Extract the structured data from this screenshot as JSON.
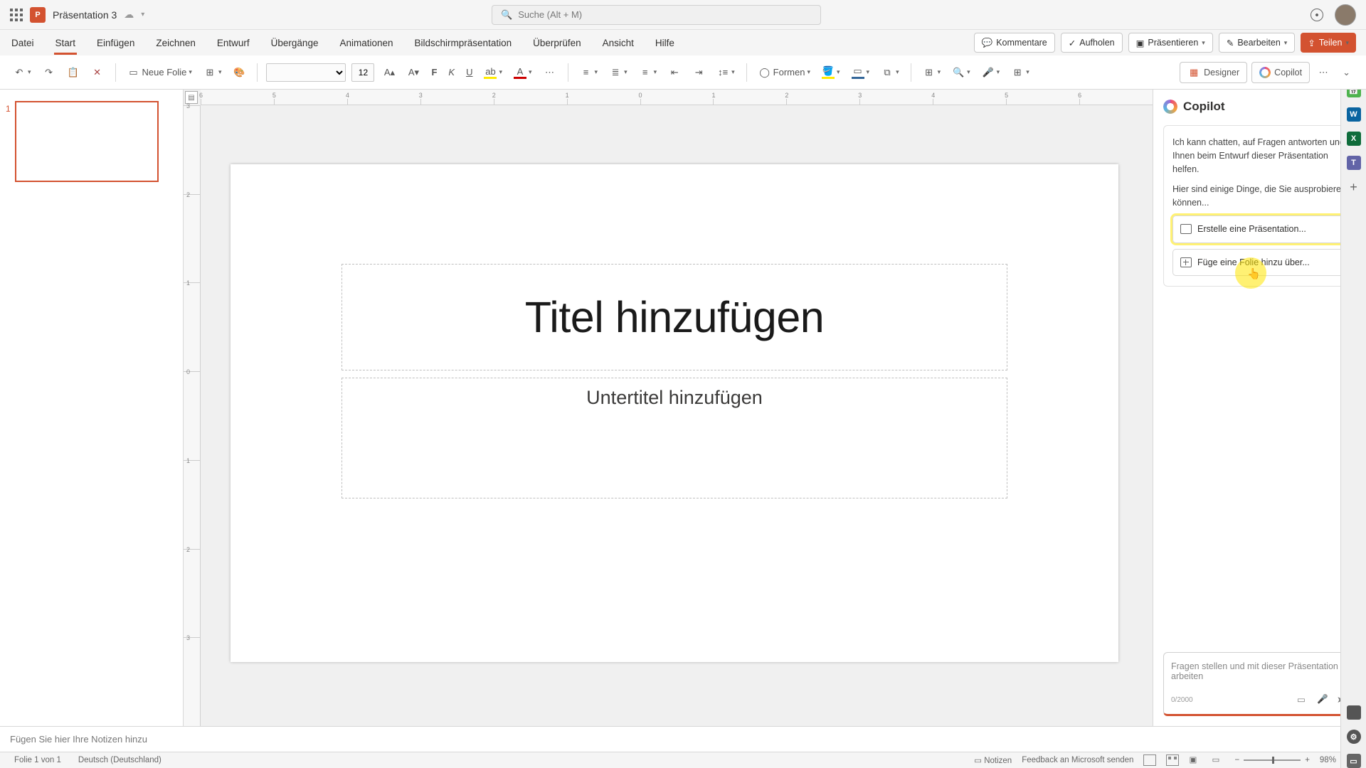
{
  "titlebar": {
    "doc_name": "Präsentation 3",
    "search_placeholder": "Suche (Alt + M)"
  },
  "tabs": {
    "datei": "Datei",
    "start": "Start",
    "einfuegen": "Einfügen",
    "zeichnen": "Zeichnen",
    "entwurf": "Entwurf",
    "uebergaenge": "Übergänge",
    "animationen": "Animationen",
    "bildschirm": "Bildschirmpräsentation",
    "ueberpruefen": "Überprüfen",
    "ansicht": "Ansicht",
    "hilfe": "Hilfe"
  },
  "ribbon_right": {
    "kommentare": "Kommentare",
    "aufholen": "Aufholen",
    "praesentieren": "Präsentieren",
    "bearbeiten": "Bearbeiten",
    "teilen": "Teilen"
  },
  "tools": {
    "neue_folie": "Neue Folie",
    "font_size": "12",
    "formen": "Formen",
    "designer": "Designer",
    "copilot": "Copilot"
  },
  "ruler_h": [
    "6",
    "5",
    "4",
    "3",
    "2",
    "1",
    "0",
    "1",
    "2",
    "3",
    "4",
    "5",
    "6"
  ],
  "ruler_v": [
    "3",
    "2",
    "1",
    "0",
    "1",
    "2",
    "3"
  ],
  "slide": {
    "title": "Titel hinzufügen",
    "subtitle": "Untertitel hinzufügen"
  },
  "thumb_num": "1",
  "copilot": {
    "title": "Copilot",
    "intro": "Ich kann chatten, auf Fragen antworten und Ihnen beim Entwurf dieser Präsentation helfen.",
    "try": "Hier sind einige Dinge, die Sie ausprobieren können...",
    "sugg1": "Erstelle eine Präsentation...",
    "sugg2": "Füge eine Folie hinzu über...",
    "input_ph": "Fragen stellen und mit dieser Präsentation arbeiten",
    "counter": "0/2000"
  },
  "notes": "Fügen Sie hier Ihre Notizen hinzu",
  "status": {
    "folie": "Folie 1 von 1",
    "lang": "Deutsch (Deutschland)",
    "notizen": "Notizen",
    "feedback": "Feedback an Microsoft senden",
    "zoom": "98%"
  }
}
